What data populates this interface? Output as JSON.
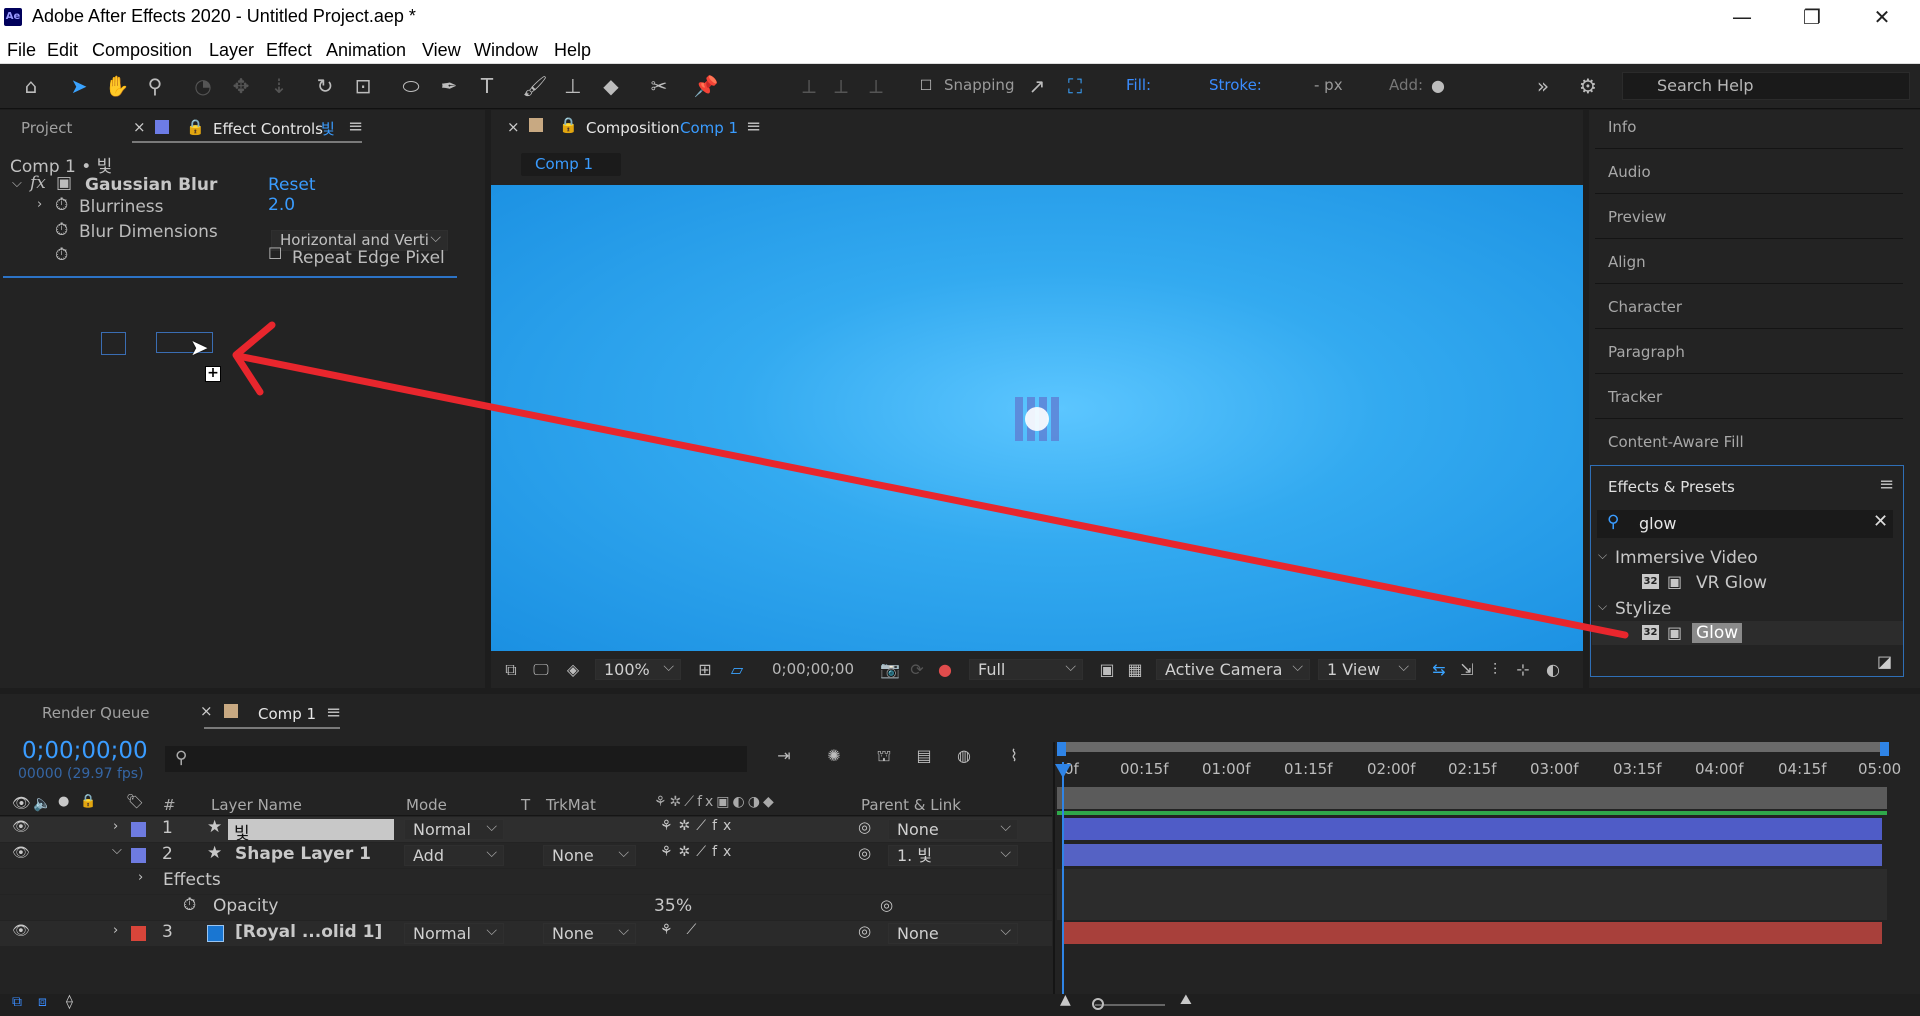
{
  "window": {
    "app_badge": "Ae",
    "title": "Adobe After Effects 2020 - Untitled Project.aep *",
    "minimize": "—",
    "restore": "❐",
    "close": "✕"
  },
  "menu": [
    "File",
    "Edit",
    "Composition",
    "Layer",
    "Effect",
    "Animation",
    "View",
    "Window",
    "Help"
  ],
  "toolbar": {
    "snapping_label": "Snapping",
    "fill_label": "Fill:",
    "stroke_label": "Stroke:",
    "stroke_units": "- px",
    "add_label": "Add:",
    "search_placeholder": "Search Help",
    "more": "»"
  },
  "left_panel": {
    "tab_project": "Project",
    "tab_effect_controls": "Effect Controls",
    "tab_layer_name": "빛",
    "breadcrumb": "Comp 1 • 빛",
    "effect_name": "Gaussian Blur",
    "reset": "Reset",
    "fx_label": "fx",
    "blurriness_label": "Blurriness",
    "blurriness_value": "2.0",
    "blur_dim_label": "Blur Dimensions",
    "blur_dim_value": "Horizontal and Verti",
    "repeat_edge_label": "Repeat Edge Pixel"
  },
  "comp_panel": {
    "tab_label": "Composition",
    "comp_name": "Comp 1",
    "subtab": "Comp 1",
    "zoom": "100%",
    "timecode": "0;00;00;00",
    "resolution": "Full",
    "camera": "Active Camera",
    "views": "1 View"
  },
  "right_panel": {
    "items": [
      "Info",
      "Audio",
      "Preview",
      "Align",
      "Character",
      "Paragraph",
      "Tracker",
      "Content-Aware Fill"
    ],
    "effects_title": "Effects & Presets",
    "search_value": "glow",
    "groups": [
      {
        "name": "Immersive Video",
        "item": "VR Glow"
      },
      {
        "name": "Stylize",
        "item": "Glow"
      }
    ],
    "badge_32": "32"
  },
  "timeline": {
    "tab_render_queue": "Render Queue",
    "tab_comp": "Comp 1",
    "timecode": "0;00;00;00",
    "fps": "00000 (29.97 fps)",
    "headers": {
      "num": "#",
      "layer_name": "Layer Name",
      "mode": "Mode",
      "t": "T",
      "trkmat": "TrkMat",
      "parent": "Parent & Link"
    },
    "ruler": [
      "0f",
      "00:15f",
      "01:00f",
      "01:15f",
      "02:00f",
      "02:15f",
      "03:00f",
      "03:15f",
      "04:00f",
      "04:15f",
      "05:00"
    ],
    "layers": [
      {
        "num": "1",
        "name": "빛",
        "mode": "Normal",
        "trkmat": "",
        "parent": "None",
        "color": "#6e7be0",
        "bar": "#4f5cc7"
      },
      {
        "num": "2",
        "name": "Shape Layer 1",
        "mode": "Add",
        "trkmat": "None",
        "parent": "1. 빛",
        "color": "#6e7be0",
        "bar": "#5562c4"
      },
      {
        "num": "3",
        "name": "[Royal ...olid 1]",
        "mode": "Normal",
        "trkmat": "None",
        "parent": "None",
        "color": "#d8453a",
        "bar": "#a8403b"
      }
    ],
    "effects_label": "Effects",
    "opacity_label": "Opacity",
    "opacity_value": "35",
    "opacity_unit": "%"
  }
}
